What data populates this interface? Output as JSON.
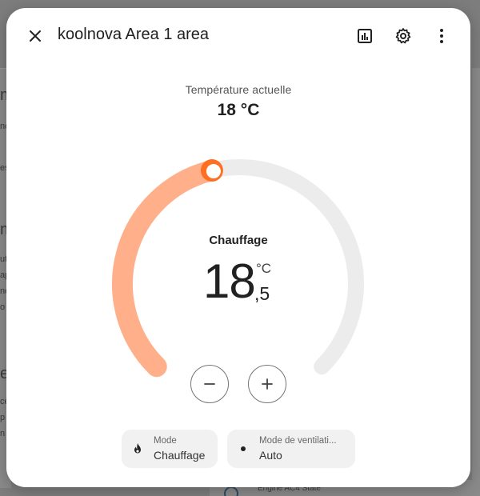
{
  "dialog": {
    "title": "koolnova Area 1 area",
    "icons": {
      "close": "close-icon",
      "history": "chart-box-icon",
      "settings": "gear-icon",
      "more": "more-vertical-icon"
    }
  },
  "current": {
    "label": "Température actuelle",
    "value": "18 °C"
  },
  "dial": {
    "mode": "Chauffage",
    "target_int": "18",
    "target_dec": ",5",
    "unit": "°C",
    "level": 0.45,
    "colors": {
      "active": "#ffb08a",
      "track": "#ececec",
      "handle": "#ff6f22"
    }
  },
  "controls": {
    "minus_icon": "minus-icon",
    "plus_icon": "plus-icon"
  },
  "chips": [
    {
      "title": "Mode",
      "value": "Chauffage",
      "icon": "fire-icon"
    },
    {
      "title": "Mode de ventilati...",
      "value": "Auto",
      "icon": "dot-icon"
    }
  ],
  "background": {
    "bottom_card_text": "Engine AC4 State",
    "fragments": [
      "m",
      "no",
      "es",
      "m",
      "ut",
      "ap",
      "ne",
      "o",
      "e",
      "cè",
      "p",
      "n"
    ]
  }
}
